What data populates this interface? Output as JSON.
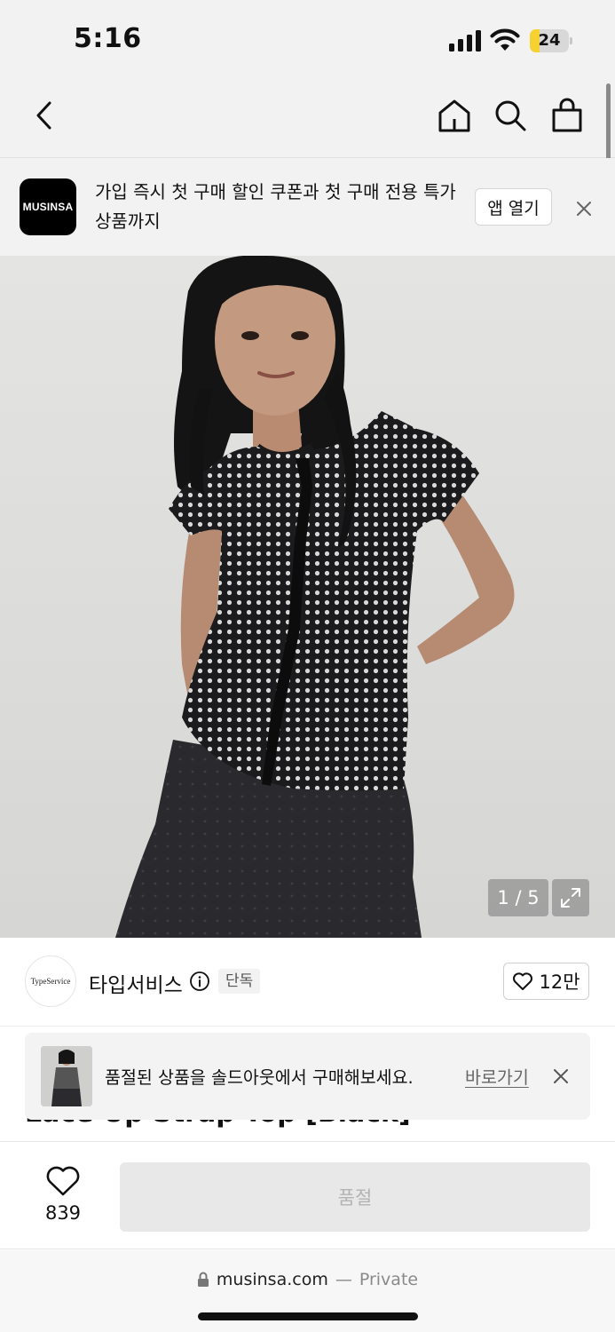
{
  "status_bar": {
    "time": "5:16",
    "battery": {
      "level": "24",
      "fraction": 0.24,
      "color": "#f5d231"
    }
  },
  "nav": {
    "back_icon": "chevron-left-icon",
    "home_icon": "home-icon",
    "search_icon": "search-icon",
    "bag_icon": "shopping-bag-icon"
  },
  "app_banner": {
    "logo_text": "MUSINSA",
    "message": "가입 즉시 첫 구매 할인 쿠폰과 첫 구매 전용 특가 상품까지",
    "open_app_label": "앱 열기",
    "close_icon": "close-icon"
  },
  "product_image": {
    "counter": "1 / 5",
    "expand_icon": "expand-icon"
  },
  "brand": {
    "logo_text": "TypeService",
    "name": "타입서비스",
    "badge": "단독",
    "like_count": "12만"
  },
  "product": {
    "title_partial": "Lace Up Strap Top [Black]"
  },
  "soldout_toast": {
    "message": "품절된 상품을 솔드아웃에서 구매해보세요.",
    "link": "바로가기"
  },
  "action_bar": {
    "wish_count": "839",
    "soldout_label": "품절"
  },
  "browser": {
    "domain": "musinsa.com",
    "separator": "—",
    "mode": "Private"
  },
  "colors": {
    "background": "#f2f2f2",
    "accent_black": "#000000",
    "disabled_button": "#e8e8e8",
    "disabled_text": "#b3b3b3"
  }
}
